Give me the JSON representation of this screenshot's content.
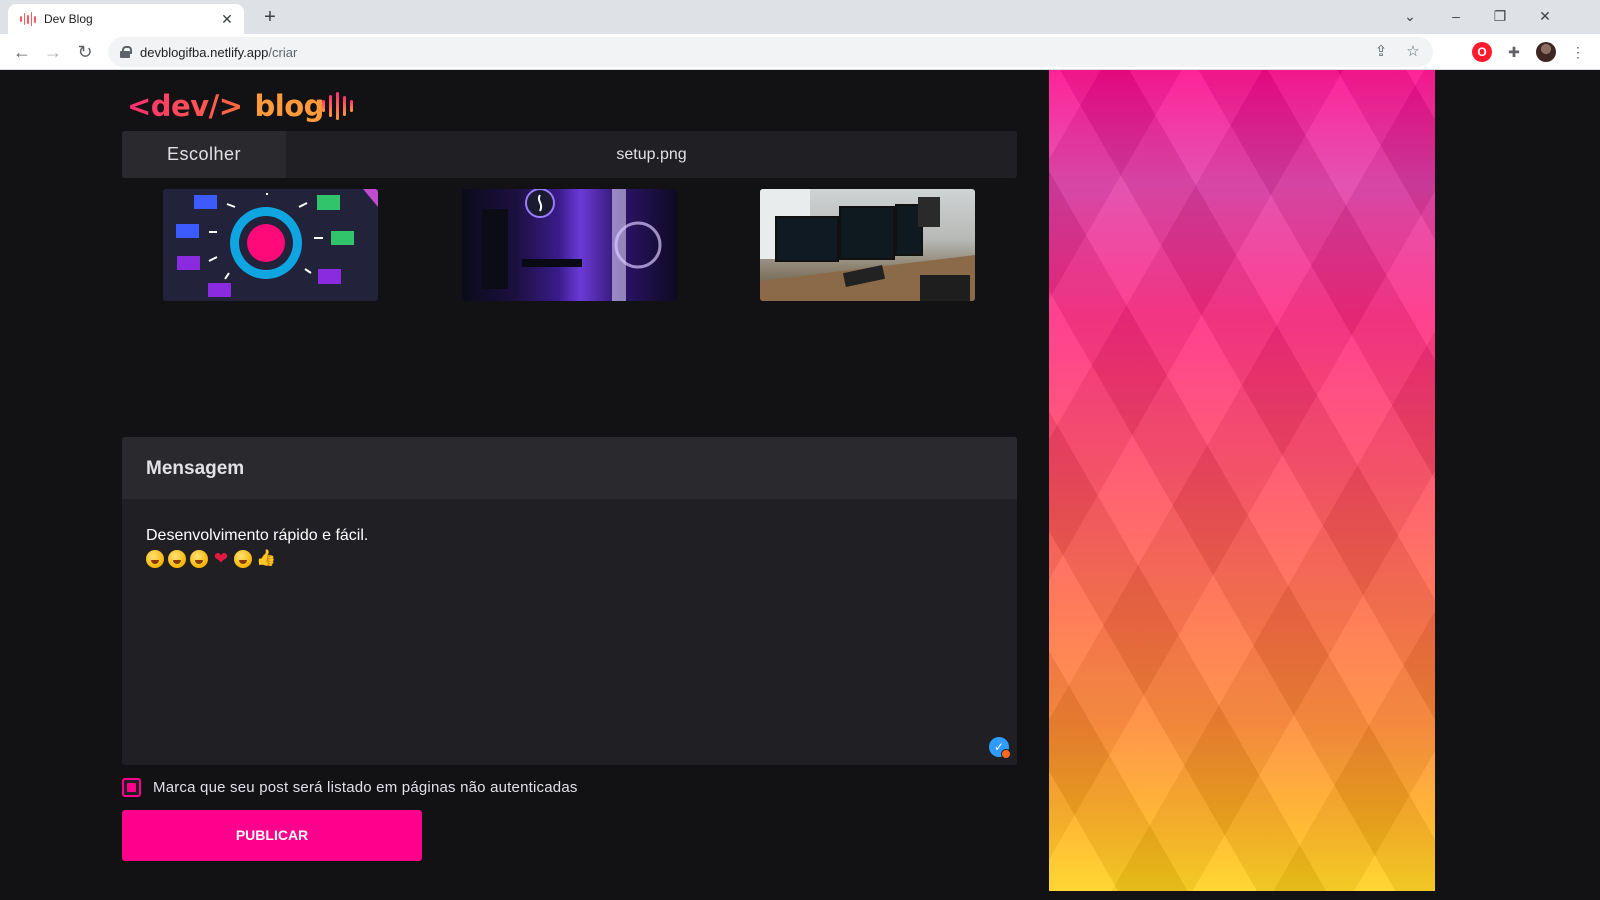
{
  "browser": {
    "tab_title": "Dev Blog",
    "url_host": "devblogifba.netlify.app",
    "url_path": "/criar"
  },
  "logo": {
    "dev_text": "<dev/>",
    "blog_text": "blog"
  },
  "file_picker": {
    "choose_label": "Escolher",
    "file_name": "setup.png"
  },
  "message": {
    "title": "Mensagem",
    "body": "Desenvolvimento rápido e fácil.",
    "emoji_line": [
      "grinning-face",
      "laughing-face",
      "rolling-laughing-face",
      "red-heart",
      "laughing-face",
      "thumbs-up"
    ]
  },
  "public_checkbox": {
    "label": "Marca que seu post será listado em páginas não autenticadas",
    "checked": true
  },
  "publish_button": {
    "label": "PUBLICAR"
  },
  "colors": {
    "accent": "#ff008c",
    "background": "#121214",
    "card": "#202024"
  }
}
